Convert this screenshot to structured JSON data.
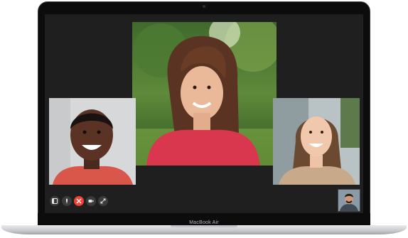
{
  "device": {
    "model_label": "MacBook Air"
  },
  "facetime": {
    "participants": [
      "main-caller",
      "left-caller",
      "right-caller"
    ],
    "self_view": "self-preview",
    "controls": [
      {
        "name": "sidebar-toggle",
        "icon": "sidebar-icon"
      },
      {
        "name": "mute",
        "icon": "microphone-icon"
      },
      {
        "name": "end-call",
        "icon": "end-call-icon",
        "color": "#f04236"
      },
      {
        "name": "camera-toggle",
        "icon": "video-camera-icon"
      },
      {
        "name": "fullscreen",
        "icon": "fullscreen-icon"
      }
    ]
  }
}
